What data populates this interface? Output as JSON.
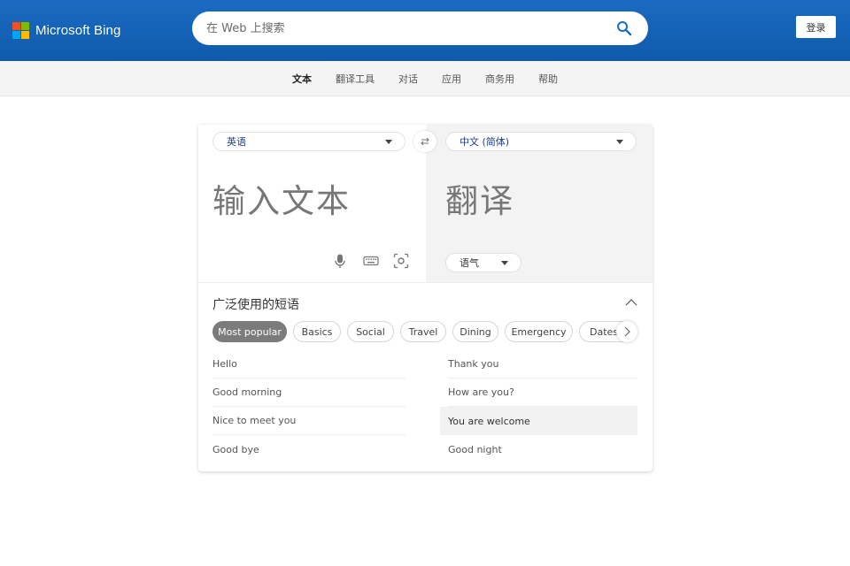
{
  "header": {
    "brand": "Microsoft Bing",
    "search_placeholder": "在 Web 上搜索",
    "login_label": "登录",
    "logo_colors": [
      "#f25022",
      "#7fba00",
      "#00a4ef",
      "#ffb900"
    ],
    "search_icon": "search-icon"
  },
  "nav": {
    "items": [
      "文本",
      "翻译工具",
      "对话",
      "应用",
      "商务用",
      "帮助"
    ],
    "active": "文本"
  },
  "translator": {
    "source_lang": "英语",
    "target_lang": "中文 (简体)",
    "input_placeholder": "输入文本",
    "output_placeholder": "翻译",
    "tone_label": "语气",
    "tools": [
      "microphone-icon",
      "keyboard-icon",
      "camera-scan-icon"
    ]
  },
  "phrases": {
    "title": "广泛使用的短语",
    "categories": [
      "Most popular",
      "Basics",
      "Social",
      "Travel",
      "Dining",
      "Emergency",
      "Dates"
    ],
    "active_category": "Most popular",
    "left": [
      "Hello",
      "Good morning",
      "Nice to meet you",
      "Good bye"
    ],
    "right": [
      "Thank you",
      "How are you?",
      "You are welcome",
      "Good night"
    ],
    "highlighted": "You are welcome"
  }
}
